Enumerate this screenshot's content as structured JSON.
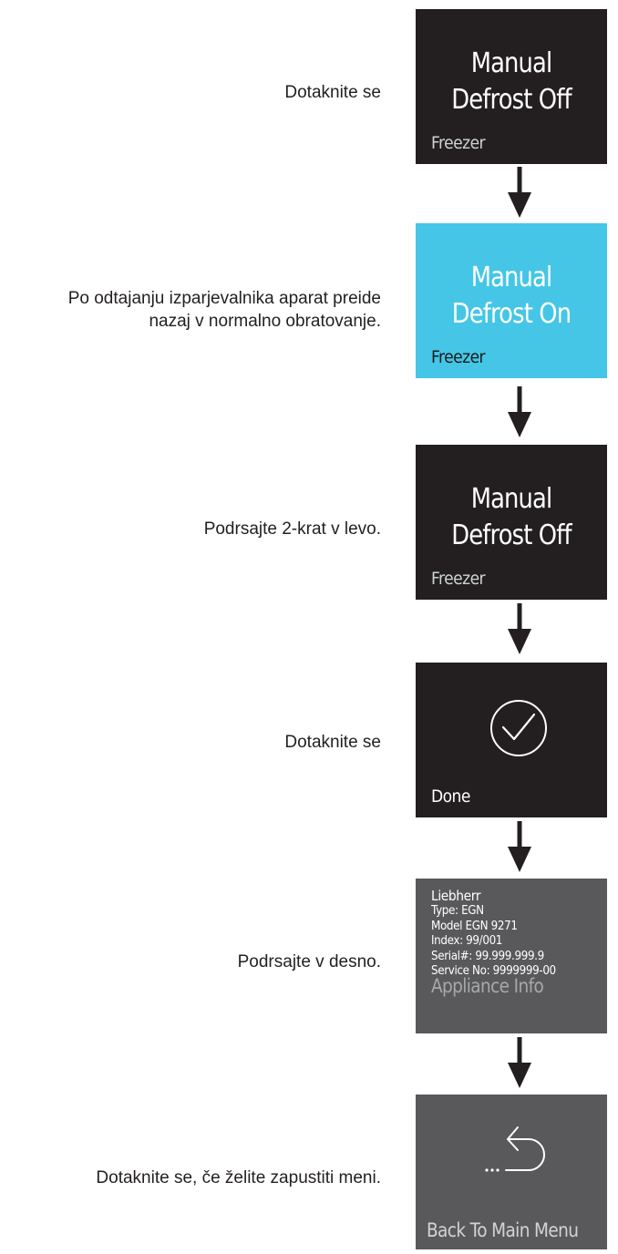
{
  "steps": [
    {
      "instruction": "Dotaknite se",
      "title": "Manual\nDefrost Off",
      "title_line1": "Manual",
      "title_line2": "Defrost Off",
      "subtitle": "Freezer"
    },
    {
      "instruction_line1": "Po odtajanju izparjevalnika aparat preide",
      "instruction_line2": "nazaj v normalno obratovanje.",
      "title_line1": "Manual",
      "title_line2": "Defrost On",
      "subtitle": "Freezer"
    },
    {
      "instruction": "Podrsajte 2-krat v levo.",
      "title_line1": "Manual",
      "title_line2": "Defrost Off",
      "subtitle": "Freezer"
    },
    {
      "instruction": "Dotaknite se",
      "icon": "checkmark-circle-icon",
      "subtitle": "Done"
    },
    {
      "instruction": "Podrsajte v desno.",
      "info": {
        "brand": "Liebherr",
        "type": "Type: EGN",
        "model": "Model EGN 9271",
        "index": "Index: 99/001",
        "serial": "Serial#: 99.999.999.9",
        "service": "Service No: 9999999-00"
      },
      "subtitle": "Appliance Info"
    },
    {
      "instruction": "Dotaknite se, če želite zapustiti meni.",
      "icon": "back-arrow-icon",
      "subtitle": "Back To Main Menu"
    }
  ],
  "colors": {
    "dark_box": "#231f20",
    "active_box": "#45c6e6",
    "grey_box": "#59595b",
    "arrow": "#231f20"
  },
  "arrow_icon": "down-arrow-icon"
}
